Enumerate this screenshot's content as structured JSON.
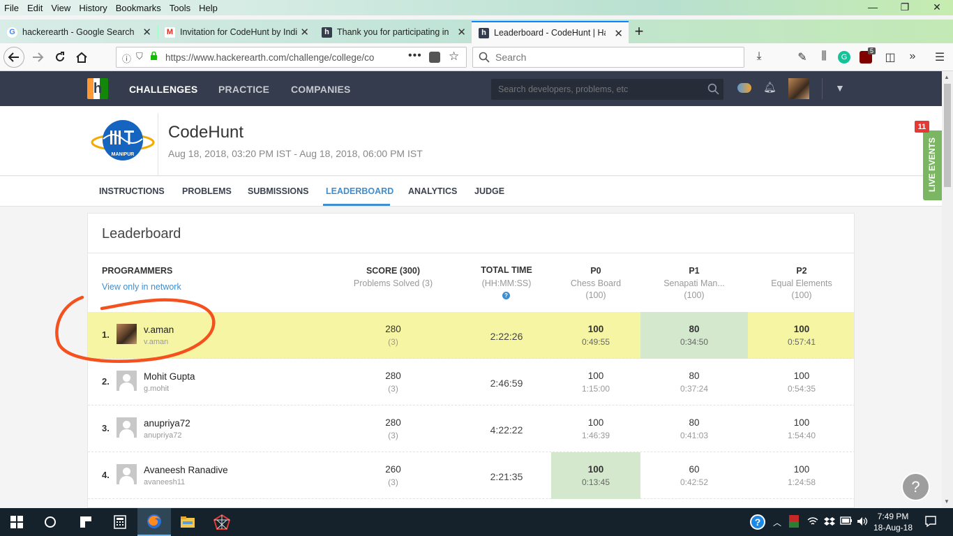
{
  "menu": [
    "File",
    "Edit",
    "View",
    "History",
    "Bookmarks",
    "Tools",
    "Help"
  ],
  "window_controls": {
    "minimize": "—",
    "maximize": "❐",
    "close": "✕"
  },
  "tabs": [
    {
      "title": "hackerearth - Google Search",
      "icon": "G"
    },
    {
      "title": "Invitation for CodeHunt by Indi",
      "icon": "M"
    },
    {
      "title": "Thank you for participating in",
      "icon": "h"
    },
    {
      "title": "Leaderboard - CodeHunt | Hac",
      "icon": "h"
    }
  ],
  "new_tab": "+",
  "url": "https://www.hackerearth.com/challenge/college/co",
  "search_placeholder": "Search",
  "badge_count": "5",
  "he_nav": [
    "CHALLENGES",
    "PRACTICE",
    "COMPANIES"
  ],
  "he_search_placeholder": "Search developers, problems, etc",
  "event": {
    "logo_text": "MANIPUR",
    "title": "CodeHunt",
    "dates": "Aug 18, 2018, 03:20 PM IST - Aug 18, 2018, 06:00 PM IST"
  },
  "event_tabs": [
    "INSTRUCTIONS",
    "PROBLEMS",
    "SUBMISSIONS",
    "LEADERBOARD",
    "ANALYTICS",
    "JUDGE"
  ],
  "live_events": {
    "label": "LIVE EVENTS",
    "count": "11"
  },
  "leaderboard": {
    "title": "Leaderboard",
    "programmers_label": "PROGRAMMERS",
    "network_link": "View only in network",
    "columns": {
      "score": {
        "title": "SCORE (300)",
        "sub": "Problems Solved (3)"
      },
      "time": {
        "title": "TOTAL TIME",
        "sub": "(HH:MM:SS)"
      },
      "p0": {
        "title": "P0",
        "sub": "Chess Board",
        "max": "(100)"
      },
      "p1": {
        "title": "P1",
        "sub": "Senapati Man...",
        "max": "(100)"
      },
      "p2": {
        "title": "P2",
        "sub": "Equal Elements",
        "max": "(100)"
      }
    },
    "rows": [
      {
        "rank": "1.",
        "name": "v.aman",
        "user": "v.aman",
        "score": "280",
        "solved": "(3)",
        "time": "2:22:26",
        "p0": "100",
        "p0t": "0:49:55",
        "p1": "80",
        "p1t": "0:34:50",
        "p2": "100",
        "p2t": "0:57:41"
      },
      {
        "rank": "2.",
        "name": "Mohit Gupta",
        "user": "g.mohit",
        "score": "280",
        "solved": "(3)",
        "time": "2:46:59",
        "p0": "100",
        "p0t": "1:15:00",
        "p1": "80",
        "p1t": "0:37:24",
        "p2": "100",
        "p2t": "0:54:35"
      },
      {
        "rank": "3.",
        "name": "anupriya72",
        "user": "anupriya72",
        "score": "280",
        "solved": "(3)",
        "time": "4:22:22",
        "p0": "100",
        "p0t": "1:46:39",
        "p1": "80",
        "p1t": "0:41:03",
        "p2": "100",
        "p2t": "1:54:40"
      },
      {
        "rank": "4.",
        "name": "Avaneesh Ranadive",
        "user": "avaneesh11",
        "score": "260",
        "solved": "(3)",
        "time": "2:21:35",
        "p0": "100",
        "p0t": "0:13:45",
        "p1": "60",
        "p1t": "0:42:52",
        "p2": "100",
        "p2t": "1:24:58"
      }
    ]
  },
  "help": "?",
  "taskbar": {
    "time": "7:49 PM",
    "date": "18-Aug-18"
  },
  "colors": {
    "accent": "#3e8ed0",
    "highlight": "#f6f5a3",
    "best_cell": "#d3e8cc",
    "annotation": "#f4511e",
    "header_bg": "#343c4d"
  }
}
